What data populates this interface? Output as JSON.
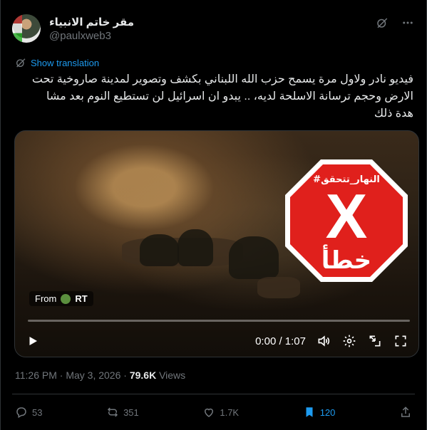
{
  "post": {
    "author_name": "مقر خاتم الانبياء",
    "author_handle": "@paulxweb3",
    "show_translation": "Show translation",
    "text_line1": "فيديو نادر ولاول مرة يسمح حزب الله اللبناني بكشف وتصوير لمدينة صاروخية تحت",
    "text_line2": "الارض وحجم ترسانة الاسلحة لديه،  ..   يبدو ان اسرائيل لن تستطيع النوم بعد مشا",
    "text_line3": "هدة ذلك",
    "timestamp": "11:26 PM · May 3, 2026 ·",
    "views_count": "79.6K",
    "views_label": "Views"
  },
  "media": {
    "from_label": "From",
    "source": "RT",
    "stamp_tag": "#النهار_تتحقق",
    "stamp_mark": "X",
    "stamp_word": "خطأ",
    "time_display": "0:00 / 1:07",
    "progress_fraction": 0
  },
  "actions": {
    "replies": "53",
    "reposts": "351",
    "likes": "1.7K",
    "bookmarks": "120"
  },
  "colors": {
    "accent": "#1d9bf0",
    "stamp_red": "#e0201c",
    "muted": "#71767b"
  }
}
